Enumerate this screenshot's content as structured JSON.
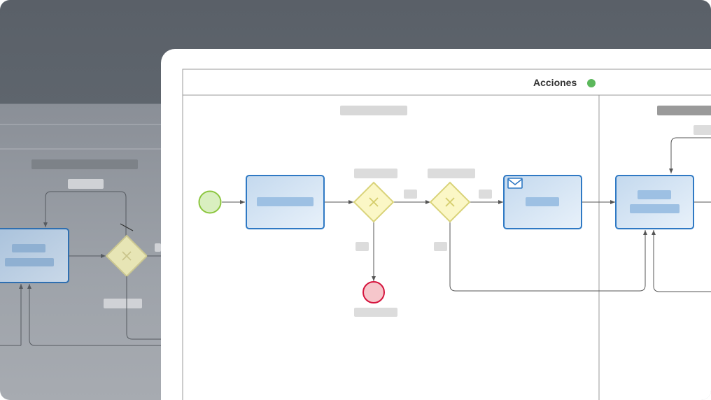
{
  "diagram": {
    "lane_title": "Acciones",
    "status_color": "#5cb85c",
    "task_fill_top": "#c7dcf0",
    "task_fill_bottom": "#e6f0fa",
    "task_stroke": "#2f79c4",
    "gateway_fill": "#fbf7c6",
    "gateway_stroke": "#d9d37a",
    "start_event_fill": "#d9efc0",
    "start_event_stroke": "#8cc63f",
    "end_event_fill": "#f6c6cb",
    "end_event_stroke": "#d5143d",
    "message_icon": "envelope-icon",
    "gateway_icon": "x-mark-icon"
  }
}
